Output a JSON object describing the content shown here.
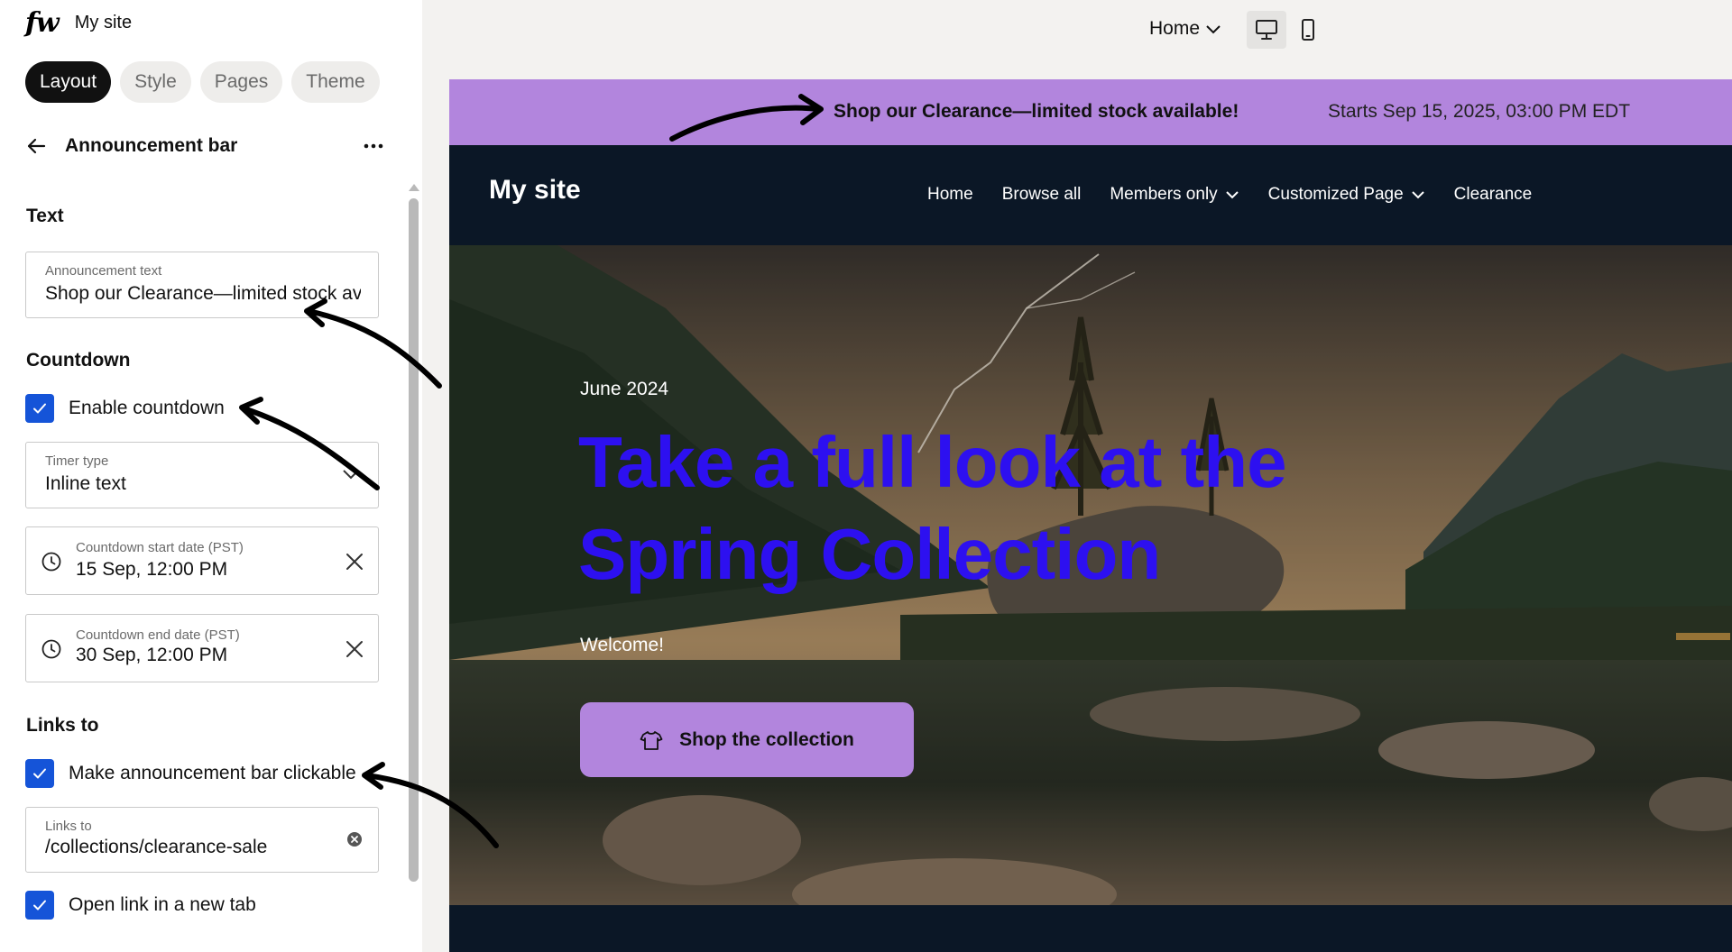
{
  "app": {
    "logo": "fw",
    "site_name": "My site",
    "tabs": [
      {
        "label": "Layout",
        "active": true
      },
      {
        "label": "Style",
        "active": false
      },
      {
        "label": "Pages",
        "active": false
      },
      {
        "label": "Theme",
        "active": false
      }
    ]
  },
  "editor": {
    "title": "Announcement bar",
    "text_section": {
      "title": "Text",
      "announcement_label": "Announcement text",
      "announcement_value": "Shop our Clearance—limited stock available!"
    },
    "countdown_section": {
      "title": "Countdown",
      "enable_label": "Enable countdown",
      "enable_checked": true,
      "timer_type_label": "Timer type",
      "timer_type_value": "Inline text",
      "start_label": "Countdown start date (PST)",
      "start_value": "15 Sep, 12:00 PM",
      "end_label": "Countdown end date (PST)",
      "end_value": "30 Sep, 12:00 PM"
    },
    "links_section": {
      "title": "Links to",
      "clickable_label": "Make announcement bar clickable",
      "clickable_checked": true,
      "links_to_label": "Links to",
      "links_to_value": "/collections/clearance-sale",
      "new_tab_label": "Open link in a new tab",
      "new_tab_checked": true
    }
  },
  "toolbar": {
    "page_select": "Home",
    "devices": [
      {
        "icon": "desktop-icon",
        "active": true
      },
      {
        "icon": "mobile-icon",
        "active": false
      }
    ]
  },
  "preview": {
    "announcement": {
      "message": "Shop our Clearance—limited stock available!",
      "countdown": "Starts Sep 15, 2025, 03:00 PM EDT",
      "background": "#b285dd"
    },
    "site_logo": "My site",
    "nav": [
      {
        "label": "Home",
        "dropdown": false
      },
      {
        "label": "Browse all",
        "dropdown": false
      },
      {
        "label": "Members only",
        "dropdown": true
      },
      {
        "label": "Customized Page",
        "dropdown": true
      },
      {
        "label": "Clearance",
        "dropdown": false
      }
    ],
    "hero": {
      "eyebrow": "June 2024",
      "headline": "Take a full look at the Spring Collection",
      "subtext": "Welcome!",
      "cta": "Shop the collection",
      "headline_color": "#2d10f0"
    }
  },
  "colors": {
    "accent": "#1554d8",
    "brand_purple": "#b285dd",
    "dark_nav": "#0b1726"
  }
}
